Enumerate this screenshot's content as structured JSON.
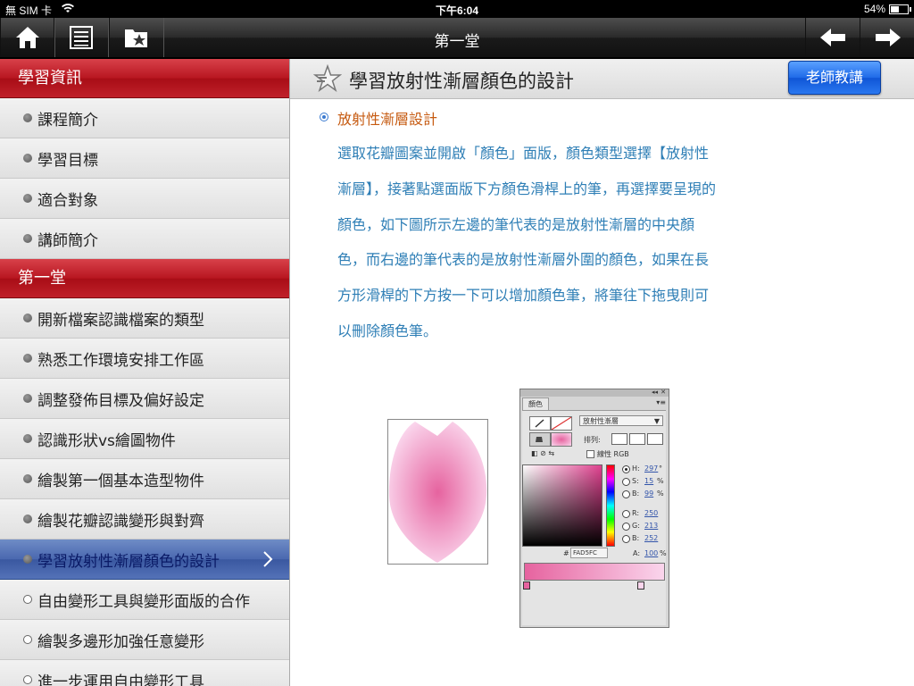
{
  "status_bar": {
    "carrier": "無 SIM 卡",
    "time": "下午6:04",
    "battery": "54%"
  },
  "toolbar": {
    "title": "第一堂"
  },
  "sidebar": {
    "sections": [
      {
        "header": "學習資訊",
        "items": [
          "課程簡介",
          "學習目標",
          "適合對象",
          "講師簡介"
        ]
      },
      {
        "header": "第一堂",
        "items": [
          "開新檔案認識檔案的類型",
          "熟悉工作環境安排工作區",
          "調整發佈目標及偏好設定",
          "認識形狀vs繪圖物件",
          "繪製第一個基本造型物件",
          "繪製花瓣認識變形與對齊",
          "學習放射性漸層顏色的設計",
          "自由變形工具與變形面版的合作",
          "繪製多邊形加強任意變形",
          "進一步運用自由變形工具"
        ]
      }
    ]
  },
  "main": {
    "title": "學習放射性漸層顏色的設計",
    "teacher_button": "老師教講",
    "subheading": "放射性漸層設計",
    "paragraph": "選取花瓣圖案並開啟「顏色」面版，顏色類型選擇【放射性漸層】，接著點選面版下方顏色滑桿上的筆，再選擇要呈現的顏色，如下圖所示左邊的筆代表的是放射性漸層的中央顏色，而右邊的筆代表的是放射性漸層外圍的顏色，如果在長方形滑桿的下方按一下可以增加顏色筆，將筆往下拖曳則可以刪除顏色筆。"
  },
  "color_panel": {
    "tab": "顏色",
    "type_select": "放射性漸層",
    "arrange_label": "排列:",
    "linear_rgb": "線性 RGB",
    "h_label": "H:",
    "h_value": "297",
    "h_unit": "°",
    "s_label": "S:",
    "s_value": "15",
    "s_unit": "%",
    "b_label": "B:",
    "b_value": "99",
    "b_unit": "%",
    "r_label": "R:",
    "r_value": "250",
    "g_label": "G:",
    "g_value": "213",
    "b2_label": "B:",
    "b2_value": "252",
    "hex_label": "#",
    "hex_value": "FAD5FC",
    "a_label": "A:",
    "a_value": "100",
    "a_unit": "%"
  },
  "colors": {
    "accent_red": "#b81620",
    "active_blue": "#4a68b0",
    "text_blue": "#2f7fb6",
    "subhead_orange": "#c65a10"
  }
}
